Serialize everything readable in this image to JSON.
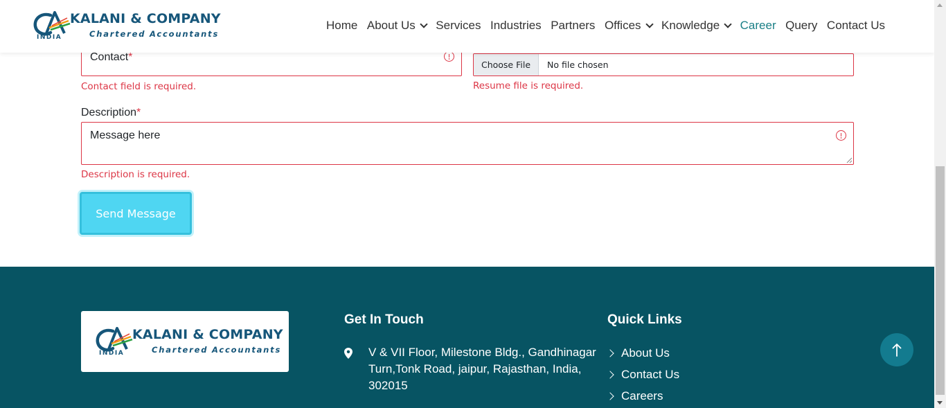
{
  "header": {
    "logo": {
      "company": "KALANI & COMPANY",
      "subtitle": "Chartered Accountants",
      "country": "INDIA"
    },
    "nav": [
      {
        "label": "Home",
        "dropdown": false,
        "active": false
      },
      {
        "label": "About Us",
        "dropdown": true,
        "active": false
      },
      {
        "label": "Services",
        "dropdown": false,
        "active": false
      },
      {
        "label": "Industries",
        "dropdown": false,
        "active": false
      },
      {
        "label": "Partners",
        "dropdown": false,
        "active": false
      },
      {
        "label": "Offices",
        "dropdown": true,
        "active": false
      },
      {
        "label": "Knowledge",
        "dropdown": true,
        "active": false
      },
      {
        "label": "Career",
        "dropdown": false,
        "active": true
      },
      {
        "label": "Query",
        "dropdown": false,
        "active": false
      },
      {
        "label": "Contact Us",
        "dropdown": false,
        "active": false
      }
    ]
  },
  "form": {
    "contact": {
      "label": "Contact",
      "required_mark": "*",
      "error": "Contact field is required."
    },
    "resume": {
      "button_label": "Choose File",
      "file_status": "No file chosen",
      "error": "Resume file is required."
    },
    "description": {
      "label": "Description",
      "required_mark": "*",
      "value": "Message here",
      "error": "Description is required."
    },
    "submit_label": "Send Message"
  },
  "footer": {
    "logo": {
      "company": "KALANI & COMPANY",
      "subtitle": "Chartered Accountants",
      "country": "INDIA"
    },
    "get_in_touch": {
      "heading": "Get In Touch",
      "address_lines": [
        "V & VII Floor, Milestone Bldg., Gandhinagar",
        "Turn,Tonk Road, jaipur, Rajasthan, India,",
        "302015"
      ]
    },
    "quick_links": {
      "heading": "Quick Links",
      "items": [
        "About Us",
        "Contact Us",
        "Careers"
      ]
    }
  },
  "colors": {
    "brand_blue": "#16567a",
    "accent_teal": "#1a7f86",
    "error_red": "#dc3545",
    "button_cyan": "#4fd6f2",
    "footer_bg": "#075463",
    "to_top_bg": "#137b8f"
  },
  "icons": {
    "address": "map-pin-icon",
    "error": "exclamation-circle-icon",
    "to_top": "arrow-up-icon",
    "dropdown": "chevron-down-icon",
    "link": "chevron-right-icon"
  }
}
